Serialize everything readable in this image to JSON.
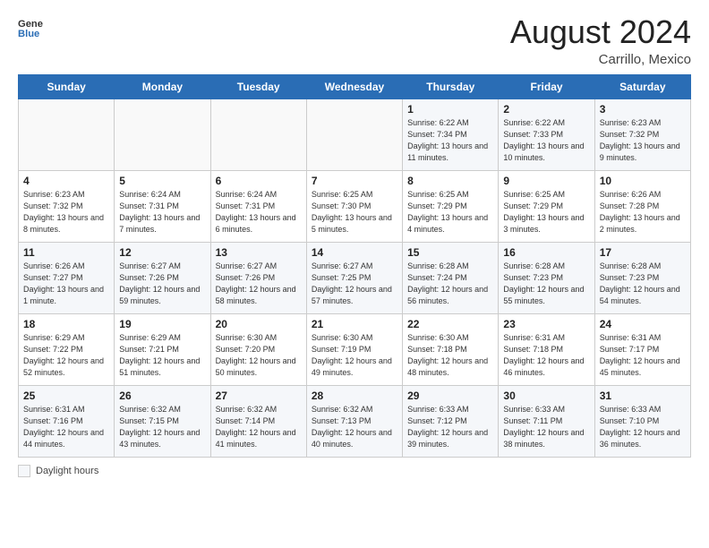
{
  "header": {
    "logo_general": "General",
    "logo_blue": "Blue",
    "month_year": "August 2024",
    "location": "Carrillo, Mexico"
  },
  "days_of_week": [
    "Sunday",
    "Monday",
    "Tuesday",
    "Wednesday",
    "Thursday",
    "Friday",
    "Saturday"
  ],
  "weeks": [
    [
      {
        "day": "",
        "content": ""
      },
      {
        "day": "",
        "content": ""
      },
      {
        "day": "",
        "content": ""
      },
      {
        "day": "",
        "content": ""
      },
      {
        "day": "1",
        "content": "Sunrise: 6:22 AM\nSunset: 7:34 PM\nDaylight: 13 hours\nand 11 minutes."
      },
      {
        "day": "2",
        "content": "Sunrise: 6:22 AM\nSunset: 7:33 PM\nDaylight: 13 hours\nand 10 minutes."
      },
      {
        "day": "3",
        "content": "Sunrise: 6:23 AM\nSunset: 7:32 PM\nDaylight: 13 hours\nand 9 minutes."
      }
    ],
    [
      {
        "day": "4",
        "content": "Sunrise: 6:23 AM\nSunset: 7:32 PM\nDaylight: 13 hours\nand 8 minutes."
      },
      {
        "day": "5",
        "content": "Sunrise: 6:24 AM\nSunset: 7:31 PM\nDaylight: 13 hours\nand 7 minutes."
      },
      {
        "day": "6",
        "content": "Sunrise: 6:24 AM\nSunset: 7:31 PM\nDaylight: 13 hours\nand 6 minutes."
      },
      {
        "day": "7",
        "content": "Sunrise: 6:25 AM\nSunset: 7:30 PM\nDaylight: 13 hours\nand 5 minutes."
      },
      {
        "day": "8",
        "content": "Sunrise: 6:25 AM\nSunset: 7:29 PM\nDaylight: 13 hours\nand 4 minutes."
      },
      {
        "day": "9",
        "content": "Sunrise: 6:25 AM\nSunset: 7:29 PM\nDaylight: 13 hours\nand 3 minutes."
      },
      {
        "day": "10",
        "content": "Sunrise: 6:26 AM\nSunset: 7:28 PM\nDaylight: 13 hours\nand 2 minutes."
      }
    ],
    [
      {
        "day": "11",
        "content": "Sunrise: 6:26 AM\nSunset: 7:27 PM\nDaylight: 13 hours\nand 1 minute."
      },
      {
        "day": "12",
        "content": "Sunrise: 6:27 AM\nSunset: 7:26 PM\nDaylight: 12 hours\nand 59 minutes."
      },
      {
        "day": "13",
        "content": "Sunrise: 6:27 AM\nSunset: 7:26 PM\nDaylight: 12 hours\nand 58 minutes."
      },
      {
        "day": "14",
        "content": "Sunrise: 6:27 AM\nSunset: 7:25 PM\nDaylight: 12 hours\nand 57 minutes."
      },
      {
        "day": "15",
        "content": "Sunrise: 6:28 AM\nSunset: 7:24 PM\nDaylight: 12 hours\nand 56 minutes."
      },
      {
        "day": "16",
        "content": "Sunrise: 6:28 AM\nSunset: 7:23 PM\nDaylight: 12 hours\nand 55 minutes."
      },
      {
        "day": "17",
        "content": "Sunrise: 6:28 AM\nSunset: 7:23 PM\nDaylight: 12 hours\nand 54 minutes."
      }
    ],
    [
      {
        "day": "18",
        "content": "Sunrise: 6:29 AM\nSunset: 7:22 PM\nDaylight: 12 hours\nand 52 minutes."
      },
      {
        "day": "19",
        "content": "Sunrise: 6:29 AM\nSunset: 7:21 PM\nDaylight: 12 hours\nand 51 minutes."
      },
      {
        "day": "20",
        "content": "Sunrise: 6:30 AM\nSunset: 7:20 PM\nDaylight: 12 hours\nand 50 minutes."
      },
      {
        "day": "21",
        "content": "Sunrise: 6:30 AM\nSunset: 7:19 PM\nDaylight: 12 hours\nand 49 minutes."
      },
      {
        "day": "22",
        "content": "Sunrise: 6:30 AM\nSunset: 7:18 PM\nDaylight: 12 hours\nand 48 minutes."
      },
      {
        "day": "23",
        "content": "Sunrise: 6:31 AM\nSunset: 7:18 PM\nDaylight: 12 hours\nand 46 minutes."
      },
      {
        "day": "24",
        "content": "Sunrise: 6:31 AM\nSunset: 7:17 PM\nDaylight: 12 hours\nand 45 minutes."
      }
    ],
    [
      {
        "day": "25",
        "content": "Sunrise: 6:31 AM\nSunset: 7:16 PM\nDaylight: 12 hours\nand 44 minutes."
      },
      {
        "day": "26",
        "content": "Sunrise: 6:32 AM\nSunset: 7:15 PM\nDaylight: 12 hours\nand 43 minutes."
      },
      {
        "day": "27",
        "content": "Sunrise: 6:32 AM\nSunset: 7:14 PM\nDaylight: 12 hours\nand 41 minutes."
      },
      {
        "day": "28",
        "content": "Sunrise: 6:32 AM\nSunset: 7:13 PM\nDaylight: 12 hours\nand 40 minutes."
      },
      {
        "day": "29",
        "content": "Sunrise: 6:33 AM\nSunset: 7:12 PM\nDaylight: 12 hours\nand 39 minutes."
      },
      {
        "day": "30",
        "content": "Sunrise: 6:33 AM\nSunset: 7:11 PM\nDaylight: 12 hours\nand 38 minutes."
      },
      {
        "day": "31",
        "content": "Sunrise: 6:33 AM\nSunset: 7:10 PM\nDaylight: 12 hours\nand 36 minutes."
      }
    ]
  ],
  "legend": {
    "box_label": "Daylight hours"
  }
}
